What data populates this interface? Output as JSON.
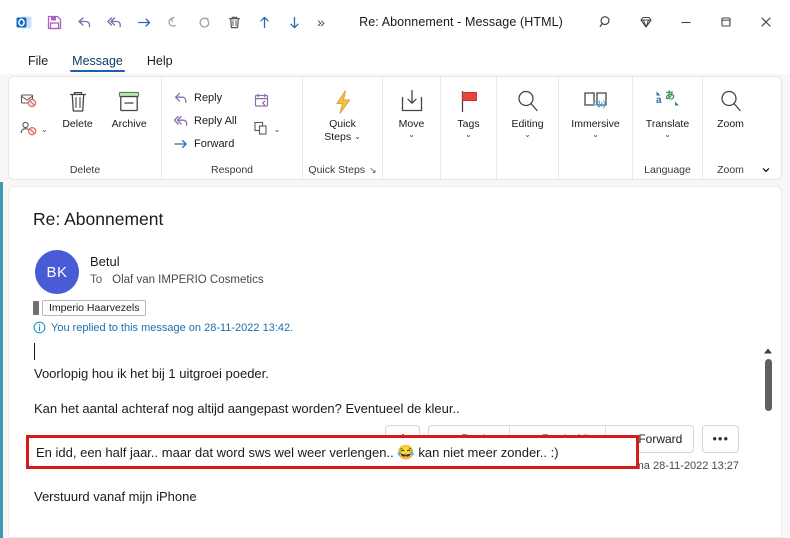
{
  "window": {
    "title": "Re: Abonnement  -  Message (HTML)",
    "quick_access": [
      {
        "name": "outlook-logo-icon",
        "label": "Outlook"
      },
      {
        "name": "save-icon",
        "label": "Save"
      },
      {
        "name": "undo-icon",
        "label": "Undo"
      },
      {
        "name": "reply-all-icon",
        "label": "Reply All"
      },
      {
        "name": "forward-arrow-icon",
        "label": "Forward"
      },
      {
        "name": "undo-curve-icon",
        "label": "Undo"
      },
      {
        "name": "redo-icon",
        "label": "Redo"
      },
      {
        "name": "delete-trash-icon",
        "label": "Delete"
      },
      {
        "name": "previous-item-icon",
        "label": "Previous Item"
      },
      {
        "name": "next-item-icon",
        "label": "Next Item"
      }
    ],
    "overflow_label": "»",
    "controls": {
      "search": "Search",
      "premium": "Premium",
      "minimize": "–",
      "maximize": "Maximize",
      "close": "✕"
    }
  },
  "tabs": [
    {
      "label": "File",
      "active": false
    },
    {
      "label": "Message",
      "active": true
    },
    {
      "label": "Help",
      "active": false
    }
  ],
  "ribbon": {
    "groups": [
      {
        "label": "Delete",
        "small_icons": [
          {
            "name": "ignore-icon",
            "label": "Ignore"
          },
          {
            "name": "block-sender-icon",
            "label": "Block"
          }
        ],
        "buttons": [
          {
            "name": "delete-button",
            "label": "Delete"
          },
          {
            "name": "archive-button",
            "label": "Archive"
          }
        ]
      },
      {
        "label": "Respond",
        "items": [
          {
            "name": "reply-button",
            "label": "Reply"
          },
          {
            "name": "reply-all-button",
            "label": "Reply All"
          },
          {
            "name": "forward-button",
            "label": "Forward"
          }
        ],
        "extra_icons": [
          {
            "name": "meeting-icon",
            "label": "Meeting"
          },
          {
            "name": "more-respond-icon",
            "label": "More"
          }
        ]
      },
      {
        "label": "Quick Steps",
        "has_dialog_launcher": true,
        "dialog_launcher_glyph": "↘",
        "buttons": [
          {
            "name": "quick-steps-button",
            "label_line1": "Quick",
            "label_line2": "Steps"
          }
        ]
      },
      {
        "label": "",
        "buttons": [
          {
            "name": "move-button",
            "label": "Move"
          }
        ]
      },
      {
        "label": "",
        "buttons": [
          {
            "name": "tags-button",
            "label": "Tags"
          }
        ]
      },
      {
        "label": "",
        "buttons": [
          {
            "name": "editing-button",
            "label": "Editing"
          }
        ]
      },
      {
        "label": "",
        "buttons": [
          {
            "name": "immersive-button",
            "label": "Immersive"
          }
        ]
      },
      {
        "label": "Language",
        "buttons": [
          {
            "name": "translate-button",
            "label": "Translate"
          }
        ]
      },
      {
        "label": "Zoom",
        "buttons": [
          {
            "name": "zoom-button",
            "label": "Zoom"
          }
        ]
      }
    ],
    "collapse_glyph": "⌄"
  },
  "message": {
    "subject": "Re: Abonnement",
    "avatar_initials": "BK",
    "avatar_color": "#4a5bd6",
    "sender": "Betul",
    "to_label": "To",
    "recipients": "Olaf van IMPERIO Cosmetics",
    "category_tag": "Imperio Haarvezels",
    "notice": "You replied to this message on 28-11-2022 13:42.",
    "timestamp": "ma 28-11-2022 13:27",
    "actions": [
      {
        "name": "thumbs-up-button",
        "label": ""
      },
      {
        "name": "reply-action-button",
        "label": "Reply"
      },
      {
        "name": "reply-all-action-button",
        "label": "Reply All"
      },
      {
        "name": "forward-action-button",
        "label": "Forward"
      },
      {
        "name": "more-actions-button",
        "label": "•••"
      }
    ],
    "body": {
      "paragraph_1": "Voorlopig hou ik het bij 1 uitgroei poeder.",
      "paragraph_2": "Kan het aantal achteraf nog altijd aangepast worden? Eventueel de kleur..",
      "highlighted_prefix": "En idd, een half jaar.. maar dat word sws wel weer verlengen..",
      "highlighted_emoji": "😂",
      "highlighted_suffix": "kan niet meer zonder.. :)",
      "signature": "Verstuurd vanaf mijn iPhone",
      "highlight_color": "#d71b1b"
    }
  }
}
